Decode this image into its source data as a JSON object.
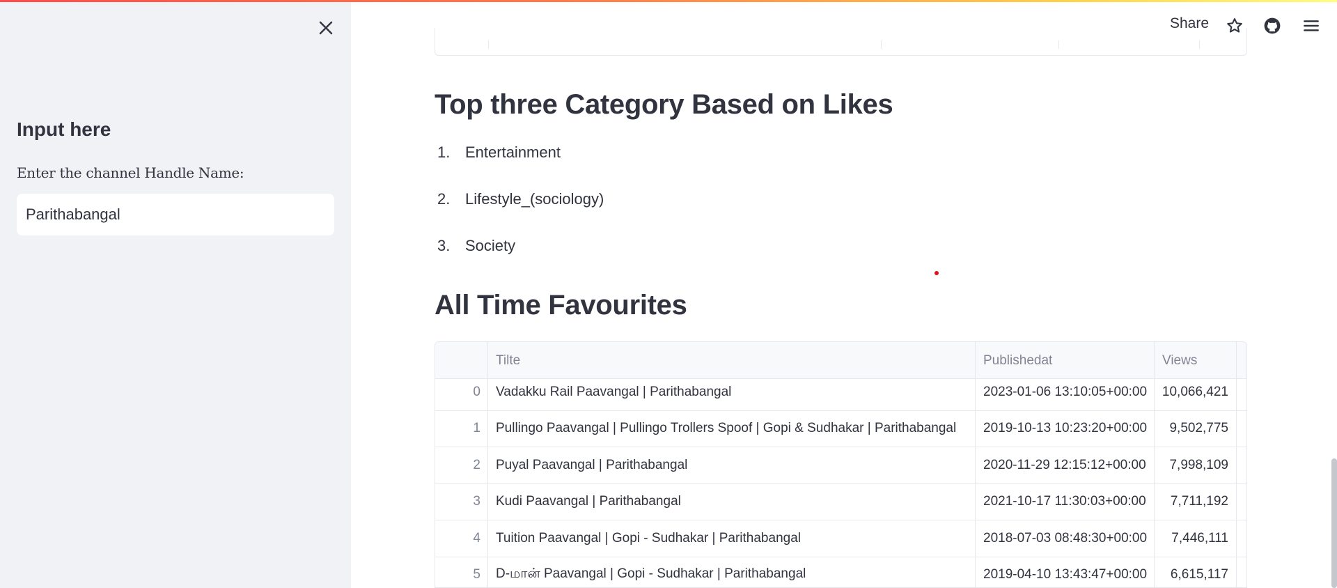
{
  "sidebar": {
    "heading": "Input here",
    "field_label": "Enter the channel Handle Name:",
    "field_value": "Parithabangal"
  },
  "header": {
    "share_label": "Share",
    "icons": [
      "star-icon",
      "github-icon",
      "menu-icon"
    ]
  },
  "categories": {
    "title": "Top three Category Based on Likes",
    "items": [
      {
        "num": "1.",
        "label": "Entertainment"
      },
      {
        "num": "2.",
        "label": "Lifestyle_(sociology)"
      },
      {
        "num": "3.",
        "label": "Society"
      }
    ]
  },
  "favourites": {
    "title": "All Time Favourites",
    "columns": [
      "",
      "Tilte",
      "Publishedat",
      "Views"
    ],
    "rows": [
      {
        "idx": "0",
        "title": "Vadakku Rail Paavangal | Parithabangal",
        "published": "2023-01-06 13:10:05+00:00",
        "views": "10,066,421"
      },
      {
        "idx": "1",
        "title": "Pullingo Paavangal | Pullingo Trollers Spoof | Gopi & Sudhakar | Parithabangal",
        "published": "2019-10-13 10:23:20+00:00",
        "views": "9,502,775"
      },
      {
        "idx": "2",
        "title": "Puyal Paavangal | Parithabangal",
        "published": "2020-11-29 12:15:12+00:00",
        "views": "7,998,109"
      },
      {
        "idx": "3",
        "title": "Kudi Paavangal | Parithabangal",
        "published": "2021-10-17 11:30:03+00:00",
        "views": "7,711,192"
      },
      {
        "idx": "4",
        "title": "Tuition Paavangal | Gopi - Sudhakar | Parithabangal",
        "published": "2018-07-03 08:48:30+00:00",
        "views": "7,446,111"
      },
      {
        "idx": "5",
        "title": "D-மான் Paavangal | Gopi - Sudhakar | Parithabangal",
        "published": "2019-04-10 13:43:47+00:00",
        "views": "6,615,117"
      }
    ]
  },
  "colors": {
    "sidebar_bg": "#f0f2f6",
    "text": "#31333f",
    "muted": "#808495",
    "accent_stripe_start": "#ff4b4b",
    "accent_stripe_end": "#fffd80"
  }
}
